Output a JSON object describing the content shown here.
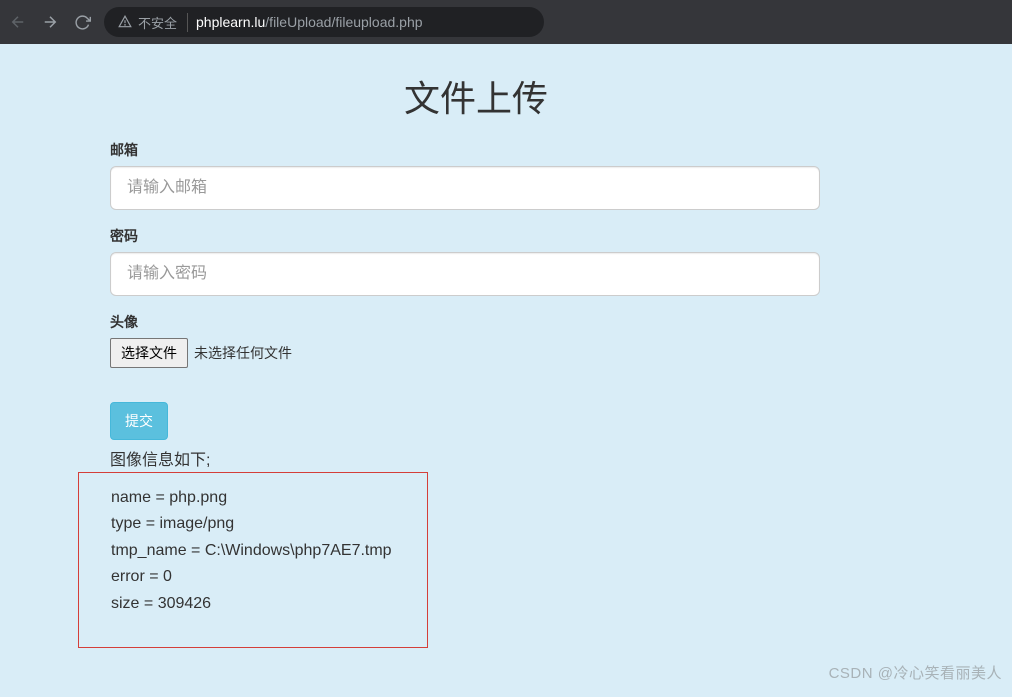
{
  "browser": {
    "not_secure_label": "不安全",
    "url_host": "phplearn.lu",
    "url_path": "/fileUpload/fileupload.php"
  },
  "page": {
    "title": "文件上传",
    "email": {
      "label": "邮箱",
      "placeholder": "请输入邮箱",
      "value": ""
    },
    "password": {
      "label": "密码",
      "placeholder": "请输入密码",
      "value": ""
    },
    "avatar": {
      "label": "头像",
      "choose_button": "选择文件",
      "no_file_text": "未选择任何文件"
    },
    "submit_label": "提交",
    "result": {
      "heading": "图像信息如下;",
      "lines": [
        "name = php.png",
        "type = image/png",
        "tmp_name = C:\\Windows\\php7AE7.tmp",
        "error = 0",
        "size = 309426"
      ]
    }
  },
  "watermark": "CSDN @冷心笑看丽美人"
}
